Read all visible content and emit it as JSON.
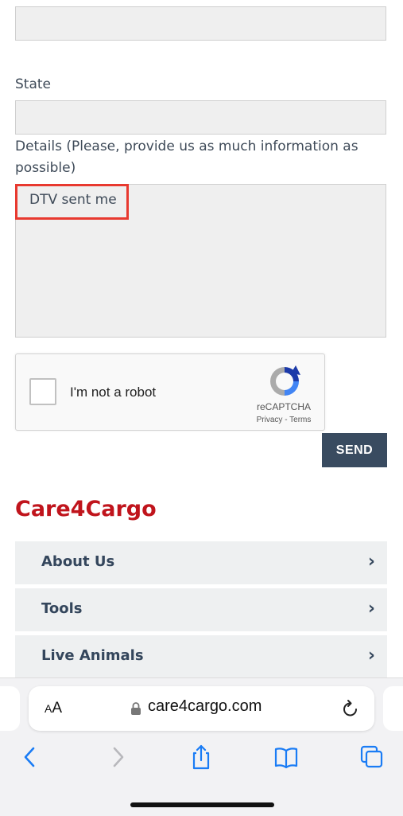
{
  "form": {
    "state_label": "State",
    "details_label": "Details (Please, provide us as much information as possible)",
    "details_value": "DTV sent me",
    "send_label": "SEND"
  },
  "recaptcha": {
    "checkbox_label": "I'm not a robot",
    "brand": "reCAPTCHA",
    "links": "Privacy - Terms"
  },
  "footer": {
    "brand": "Care4Cargo",
    "menu": [
      {
        "label": "About Us"
      },
      {
        "label": "Tools"
      },
      {
        "label": "Live Animals"
      }
    ]
  },
  "browser": {
    "text_size_label": "AA",
    "url": "care4cargo.com",
    "icons": [
      "lock-icon",
      "reload-icon",
      "back-icon",
      "forward-icon",
      "share-icon",
      "bookmarks-icon",
      "tabs-icon"
    ]
  },
  "colors": {
    "brand_red": "#c0141c",
    "button_navy": "#394b60",
    "highlight_red": "#e8392f",
    "ios_blue": "#1a7cf5"
  }
}
